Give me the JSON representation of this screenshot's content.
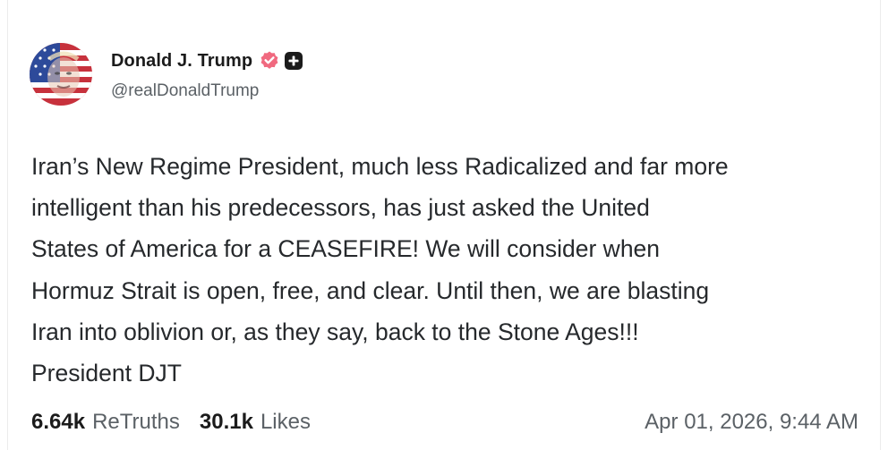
{
  "post": {
    "author": {
      "display_name": "Donald J. Trump",
      "handle": "@realDonaldTrump",
      "verified_icon": "verified-badge-icon",
      "plus_icon": "plus-badge-icon"
    },
    "body_lines": [
      "Iran’s New Regime President, much less Radicalized and far more",
      "intelligent than his predecessors, has just asked the United",
      "States of America for a CEASEFIRE! We will consider when",
      "Hormuz Strait is open, free, and clear. Until then, we are blasting",
      "Iran into oblivion or, as they say, back to the Stone Ages!!!",
      "President DJT"
    ],
    "stats": {
      "retruths_count": "6.64k",
      "retruths_label": "ReTruths",
      "likes_count": "30.1k",
      "likes_label": "Likes"
    },
    "timestamp": "Apr 01, 2026, 9:44 AM"
  },
  "colors": {
    "verified_badge": "#f0697f",
    "plus_badge": "#1b1b1b",
    "text_primary": "#26292c",
    "text_secondary": "#5b6166"
  }
}
